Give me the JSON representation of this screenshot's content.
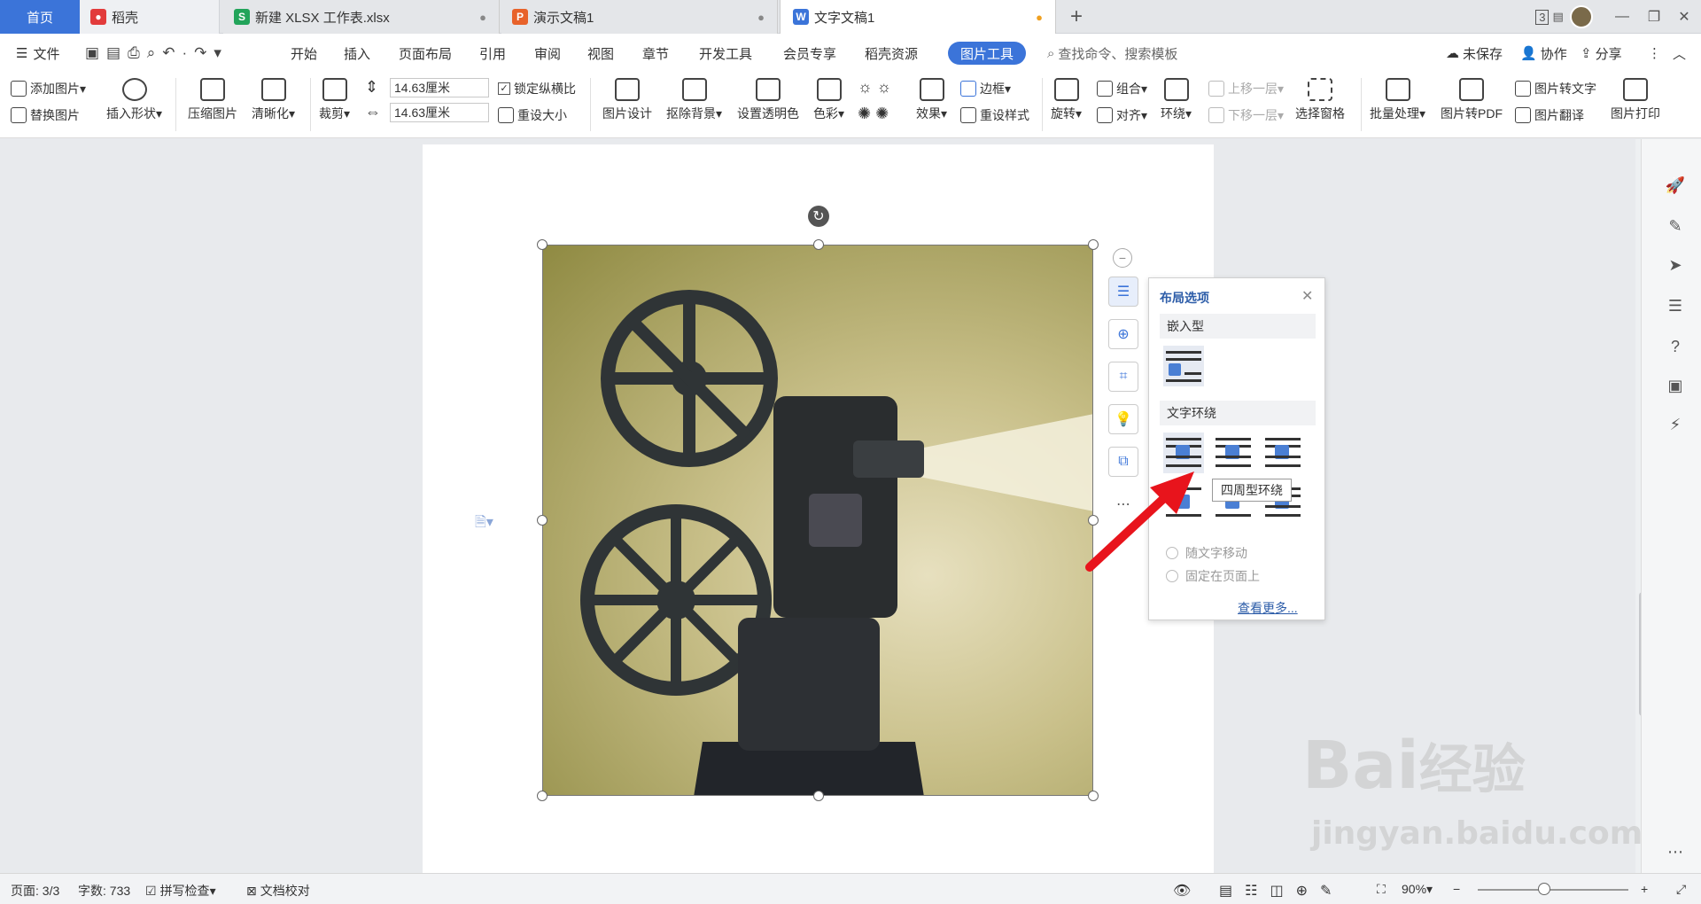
{
  "tabs": {
    "home": "首页",
    "daoke": "稻壳",
    "xlsx": "新建 XLSX 工作表.xlsx",
    "ppt": "演示文稿1",
    "doc": "文字文稿1",
    "add": "+"
  },
  "window": {
    "badge": "3"
  },
  "menubar": {
    "file": "文件",
    "items": [
      "开始",
      "插入",
      "页面布局",
      "引用",
      "审阅",
      "视图",
      "章节",
      "开发工具",
      "会员专享",
      "稻壳资源"
    ],
    "active": "图片工具",
    "search_placeholder": "查找命令、搜索模板",
    "unsaved": "未保存",
    "collab": "协作",
    "share": "分享"
  },
  "ribbon": {
    "add_picture": "添加图片",
    "replace_picture": "替换图片",
    "insert_shape": "插入形状",
    "compress_picture": "压缩图片",
    "sharpen": "清晰化",
    "crop": "裁剪",
    "height_value": "14.63厘米",
    "width_value": "14.63厘米",
    "lock_ratio": "锁定纵横比",
    "reset_size": "重设大小",
    "picture_design": "图片设计",
    "remove_bg": "抠除背景",
    "set_transparent": "设置透明色",
    "color": "色彩",
    "effects": "效果",
    "border": "边框",
    "reset_style": "重设样式",
    "rotate": "旋转",
    "group": "组合",
    "align": "对齐",
    "wrap": "环绕",
    "bring_forward": "上移一层",
    "send_backward": "下移一层",
    "selection_pane": "选择窗格",
    "batch": "批量处理",
    "to_pdf": "图片转PDF",
    "to_text": "图片转文字",
    "translate": "图片翻译",
    "print": "图片打印"
  },
  "layout_panel": {
    "title": "布局选项",
    "inline_section": "嵌入型",
    "wrap_section": "文字环绕",
    "tooltip": "四周型环绕",
    "move_with_text": "随文字移动",
    "fix_on_page": "固定在页面上",
    "see_more": "查看更多..."
  },
  "statusbar": {
    "page": "页面: 3/3",
    "words": "字数: 733",
    "spell": "拼写检查",
    "proof": "文档校对",
    "zoom": "90%"
  },
  "watermark": {
    "text1": "Bai",
    "text2": "经验",
    "url": "jingyan.baidu.com"
  },
  "colors": {
    "accent": "#3b74d9",
    "arrow": "#e8141c"
  }
}
